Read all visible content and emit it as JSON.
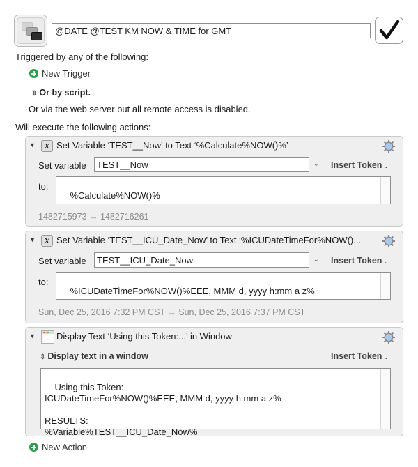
{
  "macro": {
    "icon": "macro-windows-icon",
    "name": "@DATE @TEST KM NOW & TIME for GMT",
    "enabled": true
  },
  "triggers": {
    "heading": "Triggered by any of the following:",
    "new_trigger_label": "New Trigger",
    "by_script_label": "Or by script.",
    "web_server_note": "Or via the web server but all remote access is disabled."
  },
  "actions_heading": "Will execute the following actions:",
  "actions": [
    {
      "icon": "variable-x-icon",
      "title": "Set Variable ‘TEST__Now’ to Text ‘%Calculate%NOW()%’",
      "set_variable_label": "Set variable",
      "variable": "TEST__Now",
      "insert_token_label": "Insert Token",
      "to_label": "to:",
      "text": "%Calculate%NOW()%",
      "result": "1482715973 → 1482716261"
    },
    {
      "icon": "variable-x-icon",
      "title": "Set Variable ‘TEST__ICU_Date_Now’ to Text ‘%ICUDateTimeFor%NOW()...",
      "set_variable_label": "Set variable",
      "variable": "TEST__ICU_Date_Now",
      "insert_token_label": "Insert Token",
      "to_label": "to:",
      "text": "%ICUDateTimeFor%NOW()%EEE, MMM d, yyyy h:mm a z%",
      "result": "Sun, Dec 25, 2016 7:32 PM CST → Sun, Dec 25, 2016 7:37 PM CST"
    },
    {
      "icon": "window-icon",
      "title": "Display Text ‘Using this Token:...’ in Window",
      "mode_label": "Display text in a window",
      "insert_token_label": "Insert Token",
      "text": "Using this Token:\nICUDateTimeFor%NOW()%EEE, MMM d, yyyy h:mm a z%\n\nRESULTS:\n%Variable%TEST__ICU_Date_Now%"
    }
  ],
  "new_action_label": "New Action",
  "colors": {
    "plus_green": "#27a04a",
    "gear_blue": "#a9c8f0",
    "result_gray": "#8c8c8c"
  }
}
